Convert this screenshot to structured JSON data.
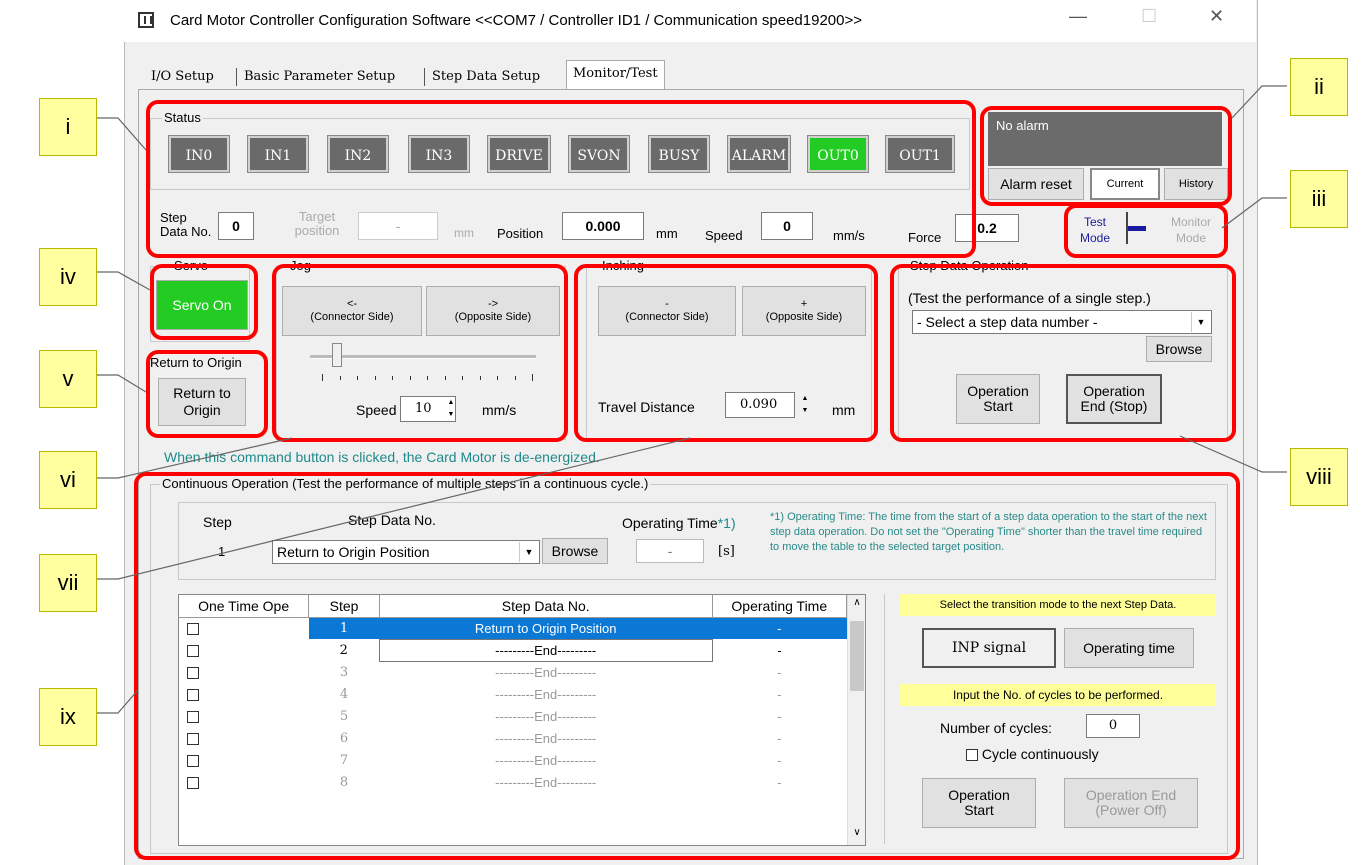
{
  "window": {
    "title": "Card Motor Controller Configuration Software <<COM7 / Controller ID1 / Communication speed19200>>",
    "minimize": "—",
    "maximize": "☐",
    "close": "✕"
  },
  "tabs": [
    "I/O Setup",
    "Basic Parameter Setup",
    "Step Data Setup",
    "Monitor/Test"
  ],
  "status": {
    "label": "Status",
    "indicators": [
      {
        "label": "IN0",
        "on": false
      },
      {
        "label": "IN1",
        "on": false
      },
      {
        "label": "IN2",
        "on": false
      },
      {
        "label": "IN3",
        "on": false
      },
      {
        "label": "DRIVE",
        "on": false
      },
      {
        "label": "SVON",
        "on": false
      },
      {
        "label": "BUSY",
        "on": false
      },
      {
        "label": "ALARM",
        "on": false
      },
      {
        "label": "OUT0",
        "on": true
      },
      {
        "label": "OUT1",
        "on": false
      }
    ]
  },
  "readouts": {
    "step_data_no_label": "Step Data No.",
    "step_data_no": "0",
    "target_label": "Target position",
    "target_value": "-",
    "target_unit": "mm",
    "position_label": "Position",
    "position": "0.000",
    "position_unit": "mm",
    "speed_label": "Speed",
    "speed": "0",
    "speed_unit": "mm/s",
    "force_label": "Force",
    "force": "0.2"
  },
  "alarm": {
    "text": "No alarm",
    "reset": "Alarm reset",
    "current": "Current",
    "history": "History"
  },
  "mode": {
    "test": "Test Mode",
    "monitor": "Monitor Mode"
  },
  "servo": {
    "label": "Servo",
    "button": "Servo On"
  },
  "origin": {
    "label": "Return to Origin",
    "button": "Return to Origin"
  },
  "jog": {
    "label": "Jog",
    "minus_arrow": "<-",
    "minus_side": "(Connector Side)",
    "plus_arrow": "->",
    "plus_side": "(Opposite Side)",
    "speed_label": "Speed",
    "speed": "10",
    "speed_unit": "mm/s",
    "slider_fraction": 0.12
  },
  "inching": {
    "label": "Inching",
    "minus_sign": "-",
    "minus_side": "(Connector Side)",
    "plus_sign": "+",
    "plus_side": "(Opposite Side)",
    "distance_label": "Travel Distance",
    "distance": "0.090",
    "unit": "mm"
  },
  "step_op": {
    "label": "Step Data Operation",
    "desc": "(Test the performance of a single step.)",
    "select": "- Select a step data number -",
    "browse": "Browse",
    "start": "Operation Start",
    "end": "Operation End (Stop)"
  },
  "hint": "When this command button is clicked, the Card Motor is de-energized.",
  "continuous": {
    "label": "Continuous Operation (Test the performance of multiple steps in a continuous cycle.)",
    "step_label": "Step",
    "step_value": "1",
    "step_data_label": "Step Data No.",
    "step_data_value": "Return to Origin Position",
    "browse": "Browse",
    "op_time_label": "Operating Time",
    "op_time_mark": "*1)",
    "op_time_value": "-",
    "op_time_unit": "[s]",
    "note": "*1) Operating Time: The time from the start of a step data operation to the start of the next step data operation. Do not set the \"Operating Time\" shorter than the travel time required to move the table to the selected target position.",
    "columns": [
      "One Time Ope",
      "Step",
      "Step Data No.",
      "Operating Time"
    ],
    "rows": [
      {
        "checked": true,
        "step": "1",
        "data": "Return to Origin Position",
        "time": "-",
        "selected": true
      },
      {
        "checked": false,
        "step": "2",
        "data": "---------End---------",
        "time": "-"
      },
      {
        "checked": false,
        "step": "3",
        "data": "---------End---------",
        "time": "-"
      },
      {
        "checked": false,
        "step": "4",
        "data": "---------End---------",
        "time": "-"
      },
      {
        "checked": false,
        "step": "5",
        "data": "---------End---------",
        "time": "-"
      },
      {
        "checked": false,
        "step": "6",
        "data": "---------End---------",
        "time": "-"
      },
      {
        "checked": false,
        "step": "7",
        "data": "---------End---------",
        "time": "-"
      },
      {
        "checked": false,
        "step": "8",
        "data": "---------End---------",
        "time": "-"
      }
    ],
    "transition_label": "Select the transition mode to the next Step Data.",
    "inp": "INP signal",
    "optime": "Operating time",
    "cycles_label": "Input the No. of cycles to be performed.",
    "num_cycles_label": "Number of cycles:",
    "num_cycles": "0",
    "cycle_cont": "Cycle continuously",
    "start": "Operation Start",
    "end": "Operation End (Power Off)"
  },
  "callouts": [
    "i",
    "ii",
    "iii",
    "iv",
    "v",
    "vi",
    "vii",
    "viii",
    "ix"
  ]
}
